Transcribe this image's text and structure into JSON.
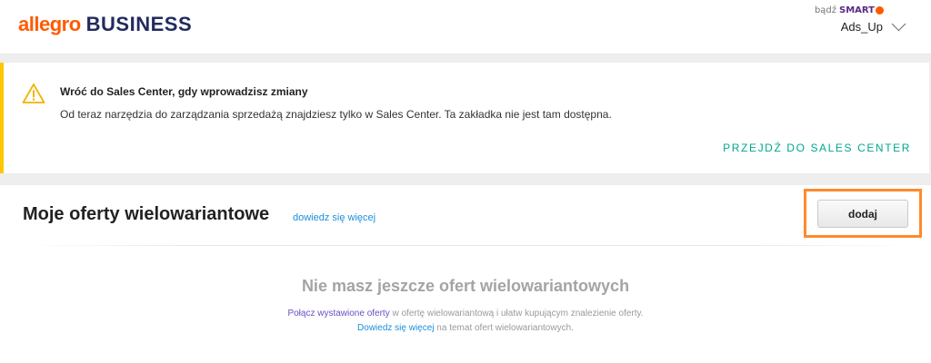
{
  "header": {
    "logo_allegro": "allegro",
    "logo_business": "BUSINESS",
    "smart_prefix": "bądź",
    "smart_label": "SMART",
    "user_name": "Ads_Up"
  },
  "banner": {
    "title": "Wróć do Sales Center, gdy wprowadzisz zmiany",
    "text": "Od teraz narzędzia do zarządzania sprzedażą znajdziesz tylko w Sales Center. Ta zakładka nie jest tam dostępna.",
    "link": "PRZEJDŹ DO SALES CENTER"
  },
  "section": {
    "title": "Moje oferty wielowariantowe",
    "learn_more": "dowiedz się więcej",
    "add_button": "dodaj"
  },
  "empty_state": {
    "title": "Nie masz jeszcze ofert wielowariantowych",
    "link1": "Połącz wystawione oferty",
    "text1": " w ofertę wielowariantową i ułatw kupującym znalezienie oferty. ",
    "link2": "Dowiedz się więcej",
    "text2": " na temat ofert wielowariantowych."
  },
  "colors": {
    "brand_orange": "#ff5a00",
    "brand_navy": "#222b5e",
    "warning_yellow": "#ffc700",
    "link_teal": "#00a790",
    "link_blue": "#1a8fde",
    "highlight_orange": "#ff8a2a"
  }
}
